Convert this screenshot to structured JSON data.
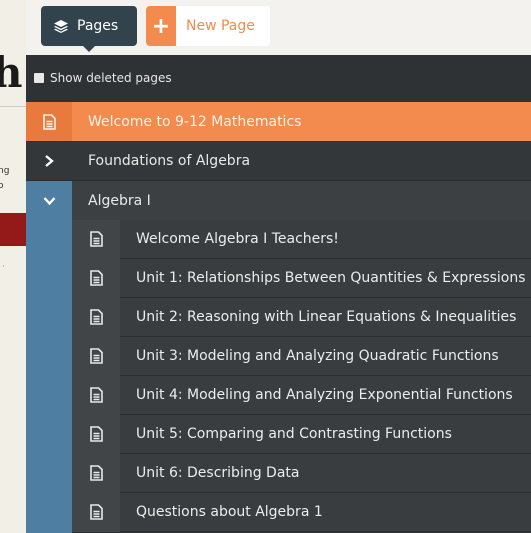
{
  "toolbar": {
    "pages_label": "Pages",
    "pages_icon": "layers-icon",
    "new_page_label": "New Page",
    "new_page_icon": "plus-icon"
  },
  "show_deleted": {
    "label": "Show deleted pages",
    "checked": false
  },
  "pages": {
    "welcome": {
      "label": "Welcome to 9-12 Mathematics",
      "icon": "document-icon",
      "active": true
    },
    "foundations": {
      "label": "Foundations of Algebra",
      "icon": "chevron-right-icon",
      "expanded": false
    },
    "algebra1": {
      "label": "Algebra I",
      "icon": "chevron-down-icon",
      "expanded": true,
      "children": [
        {
          "label": "Welcome Algebra I Teachers!",
          "icon": "document-icon"
        },
        {
          "label": "Unit 1: Relationships Between Quantities & Expressions",
          "icon": "document-icon"
        },
        {
          "label": "Unit 2: Reasoning with Linear Equations & Inequalities",
          "icon": "document-icon"
        },
        {
          "label": "Unit 3: Modeling and Analyzing Quadratic Functions",
          "icon": "document-icon"
        },
        {
          "label": "Unit 4: Modeling and Analyzing Exponential Functions",
          "icon": "document-icon"
        },
        {
          "label": "Unit 5: Comparing and Contrasting Functions",
          "icon": "document-icon"
        },
        {
          "label": "Unit 6: Describing Data",
          "icon": "document-icon"
        },
        {
          "label": "Questions about Algebra 1",
          "icon": "document-icon"
        }
      ]
    }
  },
  "colors": {
    "accent": "#f28b4d",
    "panel": "#2f3235",
    "expanded_marker": "#4e7ea2",
    "toolbar_button": "#32434d"
  },
  "background_page": {
    "text_fragment_1": "ng",
    "text_fragment_2": "o"
  }
}
